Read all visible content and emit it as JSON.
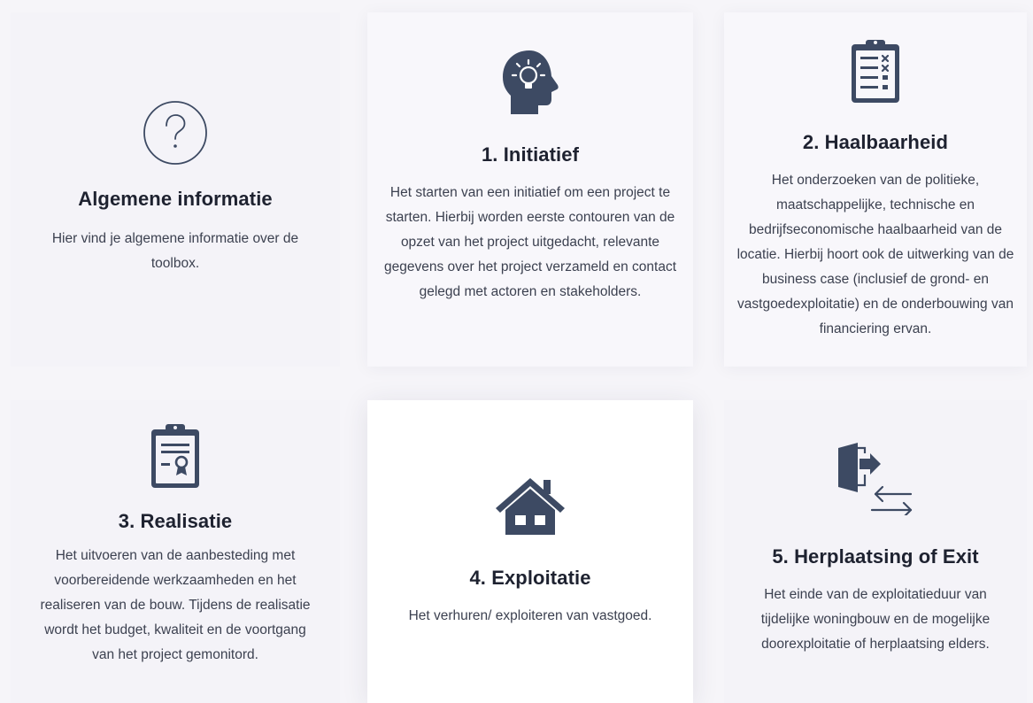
{
  "cards": [
    {
      "title": "Algemene informatie",
      "description": "Hier vind je algemene informatie over de toolbox.",
      "icon": "question-circle-icon"
    },
    {
      "title": "1. Initiatief",
      "description": "Het starten van een initiatief om een project te starten. Hierbij worden eerste contouren van de opzet van het project uitgedacht, relevante gegevens over het project verzameld en contact gelegd met actoren en stakeholders.",
      "icon": "head-lightbulb-icon"
    },
    {
      "title": "2. Haalbaarheid",
      "description": "Het onderzoeken van de politieke, maatschappelijke, technische en bedrijfseconomische haalbaarheid van de locatie. Hierbij hoort ook de uitwerking van de business case (inclusief de grond- en vastgoedexploitatie) en de onderbouwing van financiering ervan.",
      "icon": "clipboard-checklist-icon"
    },
    {
      "title": "3. Realisatie",
      "description": "Het uitvoeren van de aanbesteding met voorbereidende werkzaamheden en het realiseren van de bouw. Tijdens de realisatie wordt het budget, kwaliteit en de voortgang van het project gemonitord.",
      "icon": "clipboard-certificate-icon"
    },
    {
      "title": "4. Exploitatie",
      "description": "Het verhuren/ exploiteren van vastgoed.",
      "icon": "house-icon"
    },
    {
      "title": "5. Herplaatsing of Exit",
      "description": "Het einde van de exploitatieduur van tijdelijke woningbouw en de mogelijke doorexploitatie of herplaatsing elders.",
      "icon": "exit-arrows-icon"
    }
  ],
  "colors": {
    "icon": "#3d4a63",
    "title": "#1e2230",
    "text": "#3c4150",
    "background": "#f6f5f9"
  }
}
